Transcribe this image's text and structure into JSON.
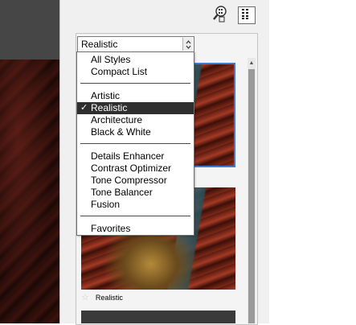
{
  "style_select": {
    "value": "Realistic"
  },
  "menu": {
    "groups": [
      [
        "All Styles",
        "Compact List"
      ],
      [
        "Artistic",
        "Realistic",
        "Architecture",
        "Black & White"
      ],
      [
        "Details Enhancer",
        "Contrast Optimizer",
        "Tone Compressor",
        "Tone Balancer",
        "Fusion"
      ],
      [
        "Favorites"
      ]
    ],
    "selected": "Realistic"
  },
  "thumbnails": [
    {
      "label": "",
      "selected": true
    },
    {
      "label": "Realistic",
      "selected": false
    }
  ],
  "colors": {
    "selection_highlight": "#2f2f2f",
    "thumbnail_border": "#3b7bd9",
    "panel_bg": "#f0f0f0"
  },
  "icons": {
    "zoom": "zoom-magnifier-icon",
    "list_view": "list-view-icon",
    "check": "checkmark-icon",
    "favorite": "star-icon"
  }
}
